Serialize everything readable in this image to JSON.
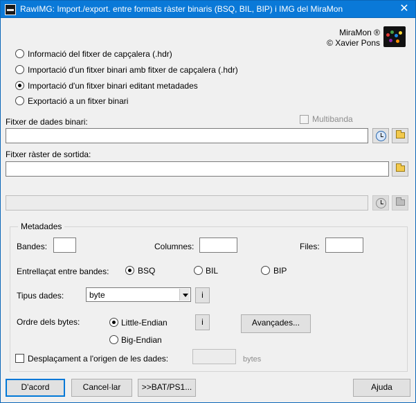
{
  "window": {
    "title": "RawIMG: Import./export. entre formats ràster binaris (BSQ, BIL, BIP) i IMG del MiraMon",
    "close_label": "✕",
    "brand_line1": "MiraMon ®",
    "brand_line2": "© Xavier Pons"
  },
  "options": [
    {
      "label": "Informació del fitxer de capçalera (.hdr)",
      "selected": false
    },
    {
      "label": "Importació d'un fitxer binari amb fitxer de capçalera (.hdr)",
      "selected": false
    },
    {
      "label": "Importació d'un fitxer binari editant metadades",
      "selected": true
    },
    {
      "label": "Exportació a un fitxer binari",
      "selected": false
    }
  ],
  "multiband_label": "Multibanda",
  "binary_file": {
    "label": "Fitxer de dades binari:",
    "value": ""
  },
  "output_file": {
    "label": "Fitxer ràster de sortida:",
    "value": ""
  },
  "third_file": {
    "value": ""
  },
  "metadata": {
    "title": "Metadades",
    "bands_label": "Bandes:",
    "bands_value": "",
    "columns_label": "Columnes:",
    "columns_value": "",
    "rows_label": "Files:",
    "rows_value": "",
    "interleave_label": "Entrellaçat entre bandes:",
    "interleave": [
      {
        "label": "BSQ",
        "selected": true
      },
      {
        "label": "BIL",
        "selected": false
      },
      {
        "label": "BIP",
        "selected": false
      }
    ],
    "data_type_label": "Tipus dades:",
    "data_type_value": "byte",
    "info_label": "i",
    "byte_order_label": "Ordre dels bytes:",
    "byte_order": [
      {
        "label": "Little-Endian",
        "selected": true
      },
      {
        "label": "Big-Endian",
        "selected": false
      }
    ],
    "advanced_label": "Avançades...",
    "offset_label": "Desplaçament a l'origen de les dades:",
    "offset_value": "",
    "offset_unit": "bytes"
  },
  "buttons": {
    "ok": "D'acord",
    "cancel": "Cancel·lar",
    "bat": ">>BAT/PS1...",
    "help": "Ajuda"
  }
}
